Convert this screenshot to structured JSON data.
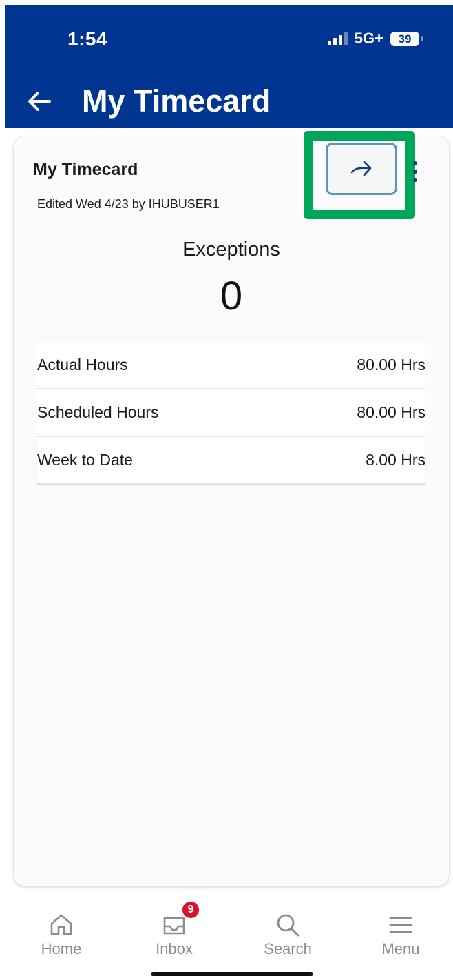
{
  "status_bar": {
    "time": "1:54",
    "network": "5G+",
    "battery": "39"
  },
  "header": {
    "title": "My Timecard"
  },
  "card": {
    "title": "My Timecard",
    "subtitle": "Edited Wed 4/23 by IHUBUSER1",
    "exceptions_label": "Exceptions",
    "exceptions_count": "0",
    "rows": [
      {
        "label": "Actual Hours",
        "value": "80.00 Hrs"
      },
      {
        "label": "Scheduled Hours",
        "value": "80.00 Hrs"
      },
      {
        "label": "Week to Date",
        "value": "8.00 Hrs"
      }
    ]
  },
  "nav": {
    "home": "Home",
    "inbox": "Inbox",
    "inbox_badge": "9",
    "search": "Search",
    "menu": "Menu"
  },
  "colors": {
    "header_bg": "#003591",
    "highlight": "#00a65a",
    "badge": "#d7132a"
  }
}
